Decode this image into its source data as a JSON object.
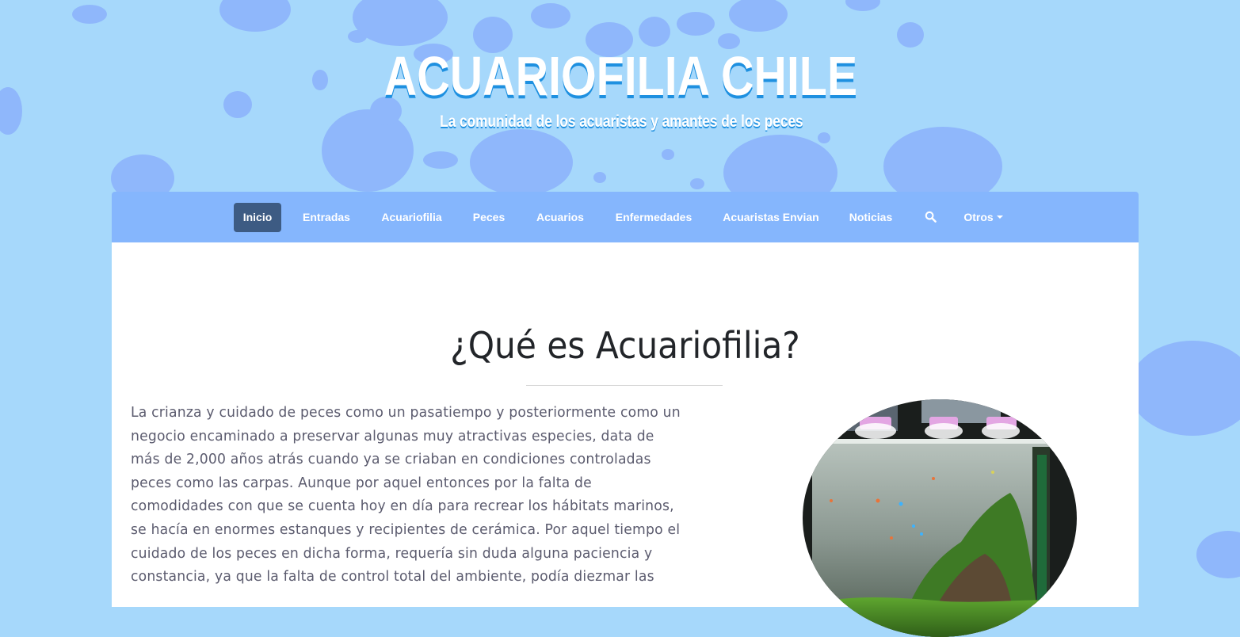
{
  "site": {
    "title": "ACUARIOFILIA CHILE",
    "tagline": "La comunidad de los acuaristas y amantes de los peces"
  },
  "nav": {
    "items": [
      {
        "label": "Inicio",
        "active": true
      },
      {
        "label": "Entradas"
      },
      {
        "label": "Acuariofilia"
      },
      {
        "label": "Peces"
      },
      {
        "label": "Acuarios"
      },
      {
        "label": "Enfermedades"
      },
      {
        "label": "Acuaristas Envian"
      },
      {
        "label": "Noticias"
      },
      {
        "icon": "search-icon"
      },
      {
        "label": "Otros",
        "icon": "caret-down-icon"
      }
    ]
  },
  "article": {
    "heading": "¿Qué es Acuariofilia?",
    "lines": [
      "La crianza y cuidado de peces como un pasatiempo y posteriormente como un",
      "negocio encaminado a preservar algunas muy atractivas especies, data de",
      "más de 2,000 años atrás cuando ya se criaban en condiciones controladas",
      "peces como las carpas. Aunque por aquel entonces por la falta de",
      "comodidades con que se cuenta hoy en día para recrear los hábitats marinos,",
      "se hacía en enormes estanques y recipientes de cerámica. Por aquel tiempo el",
      "cuidado de los peces en dicha forma, requería sin duda alguna paciencia y",
      "constancia, ya que la falta de control total del ambiente, podía diezmar las"
    ],
    "image_icon": "aquarium-photo"
  },
  "colors": {
    "background": "#a6d8fb",
    "blobs": "#8fb7fb",
    "nav": "#85b6fd",
    "nav_active": "#3d5b83",
    "title_shadow": "#1e90e0"
  }
}
